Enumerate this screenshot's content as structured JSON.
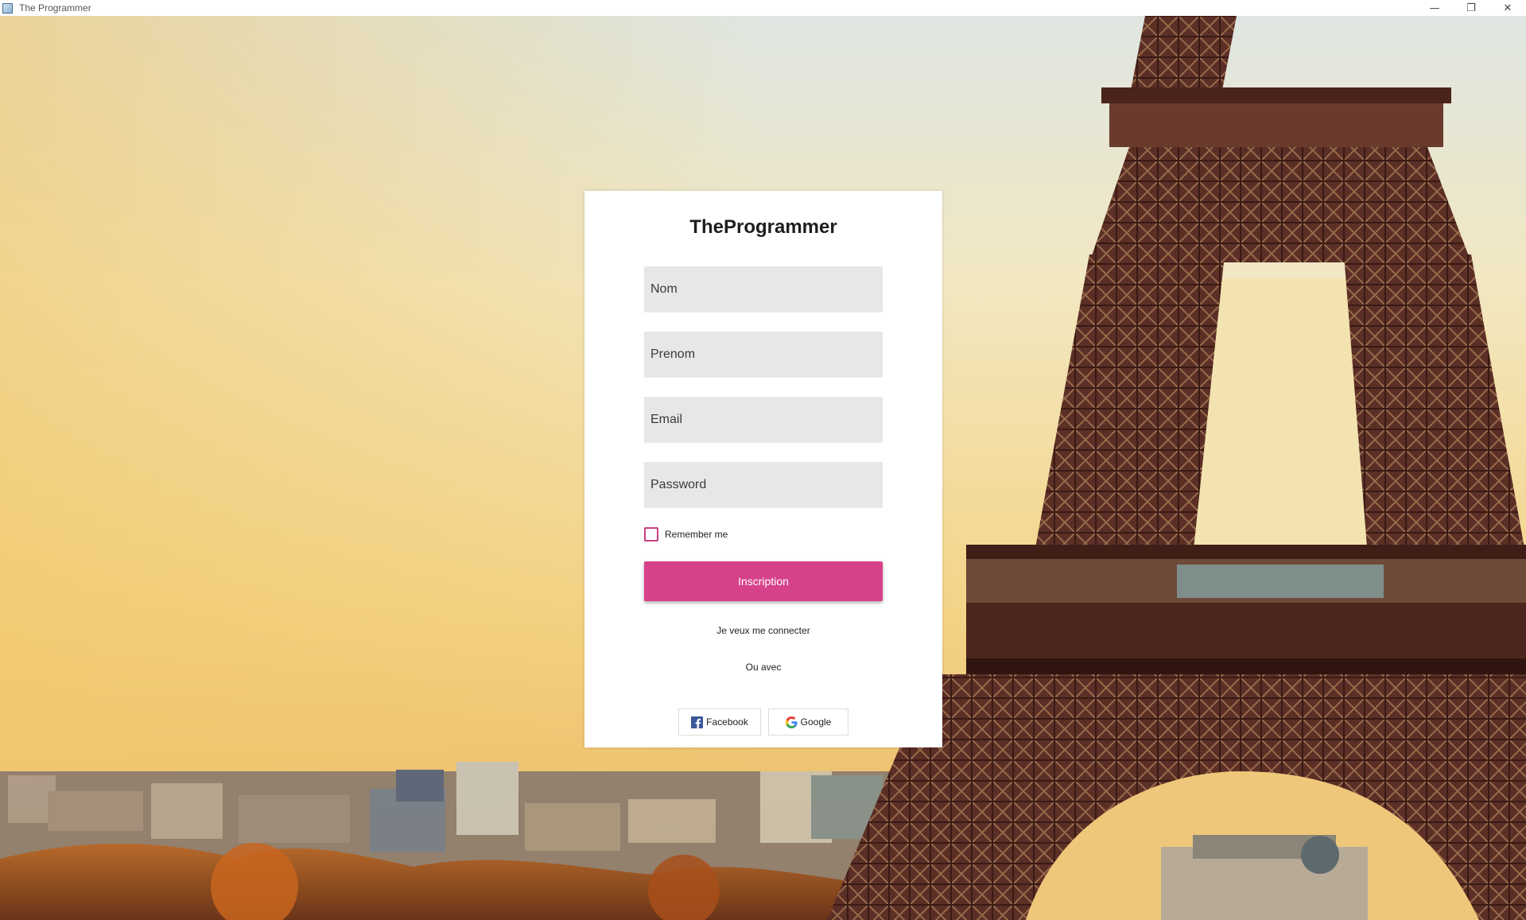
{
  "window": {
    "title": "The Programmer",
    "controls": {
      "minimize": "—",
      "restore": "❐",
      "close": "✕"
    }
  },
  "form": {
    "brand": "TheProgrammer",
    "fields": {
      "nom": {
        "placeholder": "Nom",
        "value": ""
      },
      "prenom": {
        "placeholder": "Prenom",
        "value": ""
      },
      "email": {
        "placeholder": "Email",
        "value": ""
      },
      "password": {
        "placeholder": "Password",
        "value": ""
      }
    },
    "remember_label": "Remember me",
    "remember_checked": false,
    "submit_label": "Inscription",
    "login_link": "Je veux me connecter",
    "or_with": "Ou avec",
    "social": {
      "facebook_label": "Facebook",
      "google_label": "Google"
    }
  },
  "colors": {
    "accent": "#d6428a",
    "field_bg": "#e7e7e7",
    "checkbox_border": "#c43f81",
    "facebook": "#3b5998",
    "tower": "#5a2e25"
  },
  "icons": [
    "app-icon",
    "facebook-icon",
    "google-icon",
    "minimize-icon",
    "restore-icon",
    "close-icon"
  ]
}
